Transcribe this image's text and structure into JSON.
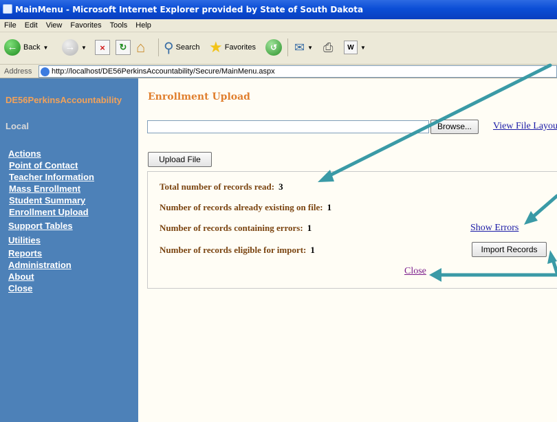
{
  "window": {
    "title": "MainMenu - Microsoft Internet Explorer provided by State of South Dakota"
  },
  "menu": [
    "File",
    "Edit",
    "View",
    "Favorites",
    "Tools",
    "Help"
  ],
  "toolbar": {
    "back_label": "Back",
    "search_label": "Search",
    "favorites_label": "Favorites"
  },
  "address": {
    "label": "Address",
    "url": "http://localhost/DE56PerkinsAccountability/Secure/MainMenu.aspx"
  },
  "sidebar": {
    "app_title": "DE56PerkinsAccountability",
    "context": "Local",
    "items": [
      {
        "label": "Actions"
      },
      {
        "label": "Point of Contact"
      },
      {
        "label": "Teacher Information"
      },
      {
        "label": "Mass Enrollment"
      },
      {
        "label": "Student Summary"
      },
      {
        "label": "Enrollment Upload"
      },
      {
        "label": "Support Tables"
      },
      {
        "label": "Utilities"
      },
      {
        "label": "Reports"
      },
      {
        "label": "Administration"
      },
      {
        "label": "About"
      },
      {
        "label": "Close"
      }
    ]
  },
  "main": {
    "title": "Enrollment Upload",
    "browse_label": "Browse...",
    "view_layout_label": "View File Layou",
    "upload_label": "Upload File",
    "stats": [
      {
        "label": "Total number of records read:",
        "value": "3"
      },
      {
        "label": "Number of records already existing on file:",
        "value": "1"
      },
      {
        "label": "Number of records containing errors:",
        "value": "1"
      },
      {
        "label": "Number of records eligible for import:",
        "value": "1"
      }
    ],
    "show_errors_label": "Show Errors",
    "import_label": "Import Records",
    "close_label": "Close"
  },
  "colors": {
    "sidebar_bg": "#4d81b8",
    "accent_orange": "#e07f2e",
    "stat_text": "#7a4410",
    "annotation_arrow": "#3a9aa6"
  }
}
